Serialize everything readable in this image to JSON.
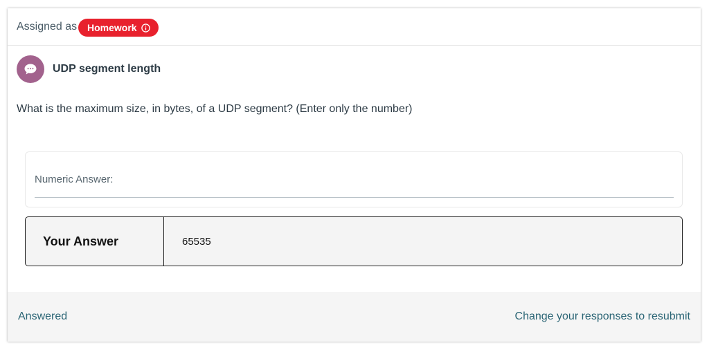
{
  "assignment": {
    "label": "Assigned as",
    "badge": "Homework",
    "badge_icon": "info-icon"
  },
  "question": {
    "avatar_icon": "chat-bubble-icon",
    "title": "UDP segment length",
    "prompt": "What is the maximum size, in bytes, of a UDP segment? (Enter only the number)"
  },
  "numeric": {
    "label": "Numeric Answer:",
    "value": ""
  },
  "answer": {
    "label": "Your Answer",
    "value": "65535"
  },
  "footer": {
    "status": "Answered",
    "resubmit_link": "Change your responses to resubmit"
  },
  "colors": {
    "badge": "#e8212d",
    "avatar": "#a2628d",
    "link": "#2b6575"
  }
}
